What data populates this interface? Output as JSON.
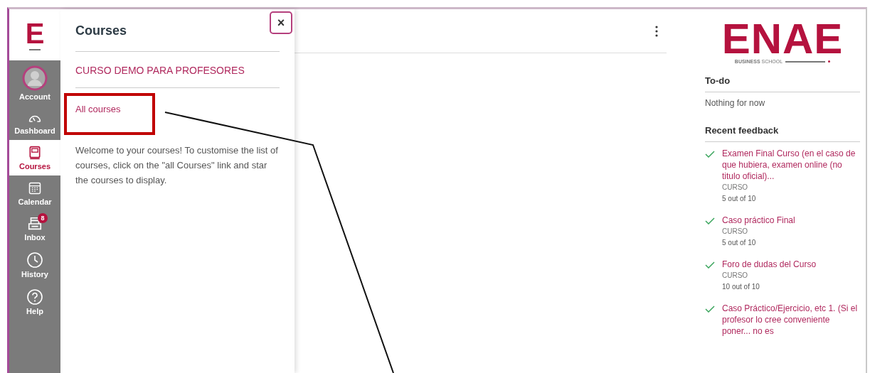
{
  "nav": {
    "logo": "E",
    "items": [
      {
        "kind": "account",
        "label": "Account",
        "selected": false
      },
      {
        "kind": "dashboard",
        "label": "Dashboard",
        "selected": false
      },
      {
        "kind": "courses",
        "label": "Courses",
        "selected": true
      },
      {
        "kind": "calendar",
        "label": "Calendar",
        "selected": false
      },
      {
        "kind": "inbox",
        "label": "Inbox",
        "selected": false,
        "badge": "8"
      },
      {
        "kind": "history",
        "label": "History",
        "selected": false
      },
      {
        "kind": "help",
        "label": "Help",
        "selected": false
      }
    ]
  },
  "tray": {
    "title": "Courses",
    "close": "×",
    "courses": [
      "CURSO DEMO PARA PROFESORES"
    ],
    "all_courses": "All courses",
    "message": "Welcome to your courses! To customise the list of courses, click on the \"all Courses\" link and star the courses to display."
  },
  "sidebar": {
    "logo": "ENAE",
    "logo_subtitle": "**BUSINESS** SCHOOL",
    "todo_title": "To-do",
    "todo_empty": "Nothing for now",
    "feedback_title": "Recent feedback",
    "feedback": [
      {
        "title": "Examen Final Curso (en el caso de que hubiera, examen online (no titulo oficial)...",
        "course": "CURSO",
        "score": "5 out of 10"
      },
      {
        "title": "Caso práctico Final",
        "course": "CURSO",
        "score": "5 out of 10"
      },
      {
        "title": "Foro de dudas del Curso",
        "course": "CURSO",
        "score": "10 out of 10"
      },
      {
        "title": "Caso Práctico/Ejercicio, etc 1. (Si el profesor lo cree conveniente poner... no es"
      }
    ]
  }
}
